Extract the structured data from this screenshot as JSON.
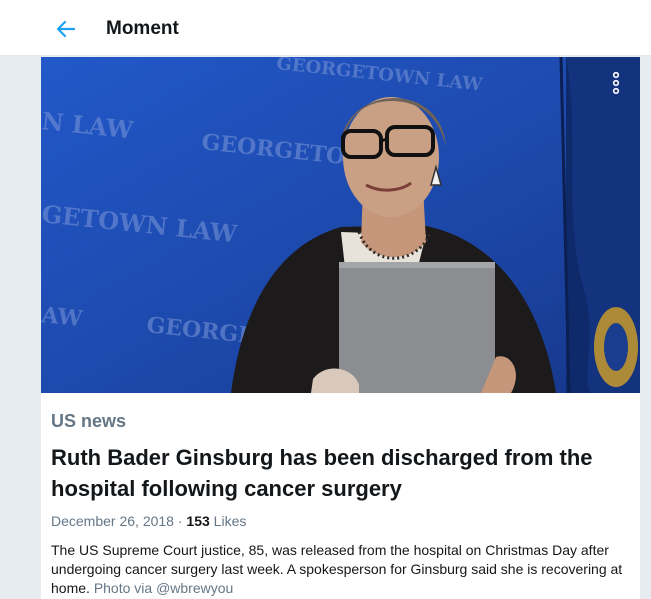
{
  "header": {
    "title": "Moment",
    "back_icon": "arrow-left-icon",
    "accent_color": "#1da1f2"
  },
  "moment": {
    "image": {
      "banner_text": [
        "GEORGETOWN LAW",
        "N LAW",
        "GEORGETO",
        "GETOWN LAW",
        "AW",
        "GEORGE"
      ],
      "more_icon": "vertical-ellipsis-icon"
    },
    "category": "US news",
    "headline": "Ruth Bader Ginsburg has been discharged from the hospital following cancer surgery",
    "date": "December 26, 2018",
    "separator": "·",
    "likes_count": "153",
    "likes_label": "Likes",
    "description": "The US Supreme Court justice, 85, was released from the hospital on Christmas Day after undergoing cancer surgery last week. A spokesperson for Ginsburg said she is recovering at home.",
    "photo_credit": "Photo via @wbrewyou"
  }
}
